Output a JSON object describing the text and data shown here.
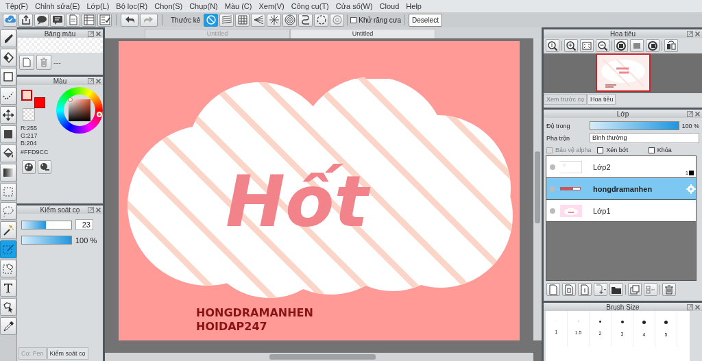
{
  "menu": [
    {
      "label": "Tệp(F)"
    },
    {
      "label": "Chỉnh sửa(E)"
    },
    {
      "label": "Lớp(L)"
    },
    {
      "label": "Bộ lọc(R)"
    },
    {
      "label": "Chọn(S)"
    },
    {
      "label": "Chụp(N)"
    },
    {
      "label": "Màu (C)"
    },
    {
      "label": "Xem(V)"
    },
    {
      "label": "Công cụ(T)"
    },
    {
      "label": "Cửa sổ(W)"
    },
    {
      "label": "Cloud"
    },
    {
      "label": "Help"
    }
  ],
  "toolbar": {
    "ruler_label": "Thước kẻ",
    "rulers": [
      {
        "kind": "none",
        "selected": true
      },
      {
        "kind": "parallel",
        "selected": false
      },
      {
        "kind": "grid",
        "selected": false
      },
      {
        "kind": "perspective",
        "selected": false
      },
      {
        "kind": "radial",
        "selected": false
      },
      {
        "kind": "concentric",
        "selected": false
      },
      {
        "kind": "curve",
        "selected": false
      },
      {
        "kind": "ellipse",
        "selected": false
      },
      {
        "kind": "symmetry",
        "selected": false
      }
    ],
    "antialias": {
      "label": "Khử răng cưa",
      "checked": false
    },
    "deselect": "Deselect"
  },
  "tools": [
    {
      "kind": "brush",
      "selected": false
    },
    {
      "kind": "eraser",
      "selected": false
    },
    {
      "kind": "rect",
      "selected": false
    },
    {
      "kind": "dotline",
      "selected": false
    },
    {
      "kind": "move",
      "selected": false
    },
    {
      "kind": "fill-rect",
      "selected": false
    },
    {
      "kind": "bucket",
      "selected": false
    },
    {
      "kind": "gradient",
      "selected": false
    },
    {
      "kind": "select-rect",
      "selected": false
    },
    {
      "kind": "lasso",
      "selected": false
    },
    {
      "kind": "wand",
      "selected": false
    },
    {
      "kind": "select-pen",
      "selected": true
    },
    {
      "kind": "select-eraser",
      "selected": false
    },
    {
      "kind": "text",
      "selected": false
    },
    {
      "kind": "operation",
      "selected": false
    },
    {
      "kind": "dropper",
      "selected": false
    }
  ],
  "palette_panel": {
    "title": "Bảng màu",
    "palette_name": "---"
  },
  "color_panel": {
    "title": "Màu",
    "swatches": [
      {
        "color": "#ffd9cc"
      },
      {
        "color": "#ff0000"
      }
    ],
    "r": "R:255",
    "g": "G:217",
    "b": "B:204",
    "hex": "#FFD9CC"
  },
  "brush_panel": {
    "title": "Kiểm soát cọ",
    "size": {
      "level": 0.48,
      "value": "23"
    },
    "opacity": {
      "level": 1,
      "reading": "100 %"
    }
  },
  "left_tabs": [
    {
      "label": "Cọ: Pen",
      "selected": false
    },
    {
      "label": "Kiểm soát cọ",
      "selected": true
    }
  ],
  "document_tabs": [
    {
      "label": "Untitled",
      "selected": false
    },
    {
      "label": "Untitled",
      "selected": true
    }
  ],
  "artwork": {
    "title": "Hốt",
    "credits": [
      "HONGDRAMANHEN",
      "HOIDAP247"
    ]
  },
  "navigator": {
    "title": "Hoa tiêu",
    "tabs": [
      {
        "label": "Xem trước cọ",
        "selected": false
      },
      {
        "label": "Hoa tiêu",
        "selected": true
      }
    ]
  },
  "layers": {
    "title": "Lớp",
    "opacity_label": "Độ trong",
    "opacity": {
      "level": 1,
      "reading": "100 %"
    },
    "blend_label": "Pha trộn",
    "blend": "Bình thường",
    "options": [
      {
        "label": "Bảo vệ alpha",
        "checked": false,
        "disabled": true
      },
      {
        "label": "Xén bớt",
        "checked": false,
        "disabled": false
      },
      {
        "label": "Khóa",
        "checked": false,
        "disabled": false
      }
    ],
    "items": [
      {
        "name": "Lớp2",
        "kind": "transparent",
        "selected": false,
        "badge": "1"
      },
      {
        "name": "hongdramanhen",
        "kind": "text",
        "selected": true
      },
      {
        "name": "Lớp1",
        "kind": "art",
        "selected": false
      }
    ]
  },
  "brush_size": {
    "title": "Brush Size",
    "sizes": [
      "1",
      "1.5",
      "2",
      "3",
      "4",
      "5"
    ]
  }
}
